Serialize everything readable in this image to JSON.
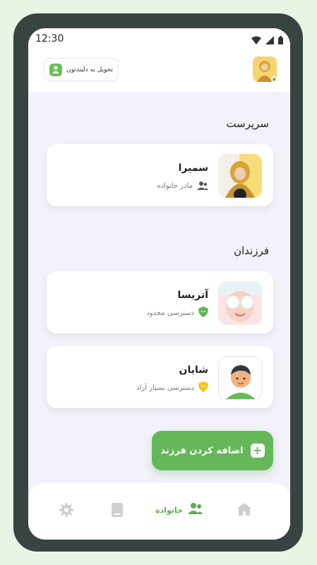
{
  "statusbar": {
    "time": "12:30"
  },
  "header": {
    "delivery_label": "تحویل به دلبندتون"
  },
  "guardian_section": {
    "title": "سرپرست",
    "card": {
      "name": "سمیرا",
      "role": "مادر خانواده"
    }
  },
  "children_section": {
    "title": "فرزندان",
    "children": [
      {
        "name": "آتریسا",
        "access": "دسترسی محدود",
        "badge_color": "#5bb84c",
        "badge_icon": "shield-icon"
      },
      {
        "name": "شایان",
        "access": "دسترسی بسیار آزاد",
        "badge_color": "#f3c21c",
        "badge_icon": "shield-icon"
      }
    ]
  },
  "add_button": {
    "label": "اضافه کردن فرزند",
    "plus": "+"
  },
  "bottom_nav": {
    "items": [
      {
        "id": "home",
        "icon": "home-icon"
      },
      {
        "id": "family",
        "icon": "users-icon",
        "label": "خانواده",
        "active": true
      },
      {
        "id": "device",
        "icon": "device-icon"
      },
      {
        "id": "settings",
        "icon": "gear-icon"
      }
    ]
  },
  "colors": {
    "accent": "#66b75a",
    "frame": "#374442",
    "background": "#f3f2fa"
  }
}
